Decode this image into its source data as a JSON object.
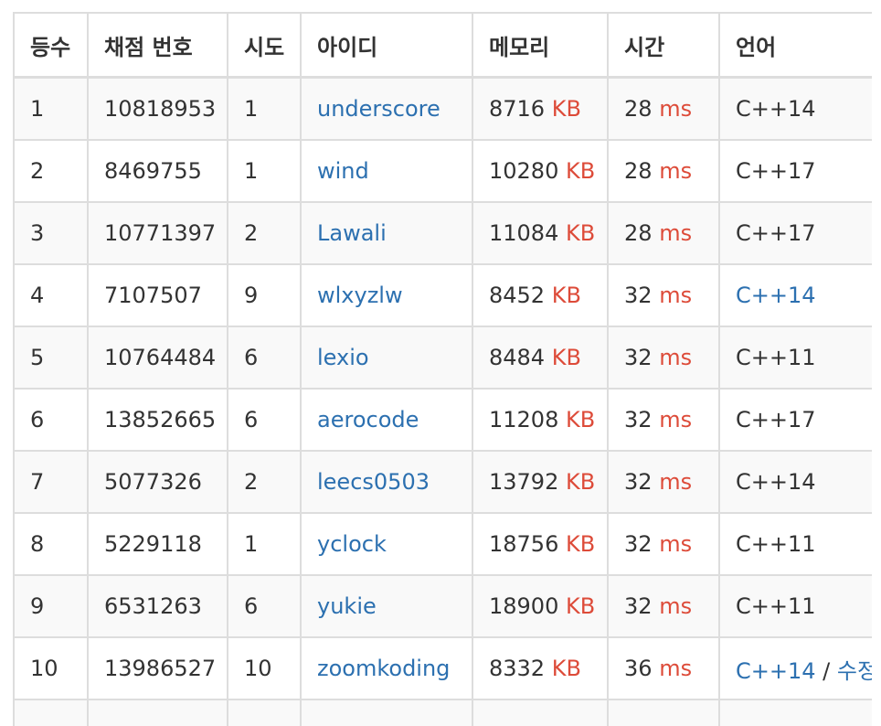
{
  "table": {
    "headers": [
      "등수",
      "채점 번호",
      "시도",
      "아이디",
      "메모리",
      "시간",
      "언어"
    ],
    "mem_unit": "KB",
    "time_unit": "ms",
    "rows": [
      {
        "rank": "1",
        "submission": "10818953",
        "tries": "1",
        "user": "underscore",
        "memory": "8716",
        "time": "28",
        "lang": "C++14",
        "lang_link": false
      },
      {
        "rank": "2",
        "submission": "8469755",
        "tries": "1",
        "user": "wind",
        "memory": "10280",
        "time": "28",
        "lang": "C++17",
        "lang_link": false
      },
      {
        "rank": "3",
        "submission": "10771397",
        "tries": "2",
        "user": "Lawali",
        "memory": "11084",
        "time": "28",
        "lang": "C++17",
        "lang_link": false
      },
      {
        "rank": "4",
        "submission": "7107507",
        "tries": "9",
        "user": "wlxyzlw",
        "memory": "8452",
        "time": "32",
        "lang": "C++14",
        "lang_link": true
      },
      {
        "rank": "5",
        "submission": "10764484",
        "tries": "6",
        "user": "lexio",
        "memory": "8484",
        "time": "32",
        "lang": "C++11",
        "lang_link": false
      },
      {
        "rank": "6",
        "submission": "13852665",
        "tries": "6",
        "user": "aerocode",
        "memory": "11208",
        "time": "32",
        "lang": "C++17",
        "lang_link": false
      },
      {
        "rank": "7",
        "submission": "5077326",
        "tries": "2",
        "user": "leecs0503",
        "memory": "13792",
        "time": "32",
        "lang": "C++14",
        "lang_link": false
      },
      {
        "rank": "8",
        "submission": "5229118",
        "tries": "1",
        "user": "yclock",
        "memory": "18756",
        "time": "32",
        "lang": "C++11",
        "lang_link": false
      },
      {
        "rank": "9",
        "submission": "6531263",
        "tries": "6",
        "user": "yukie",
        "memory": "18900",
        "time": "32",
        "lang": "C++11",
        "lang_link": false
      },
      {
        "rank": "10",
        "submission": "13986527",
        "tries": "10",
        "user": "zoomkoding",
        "memory": "8332",
        "time": "36",
        "lang": "C++14",
        "lang_link": true,
        "edit_sep": "/",
        "edit_label": "수정"
      }
    ]
  },
  "colors": {
    "link": "#2c70b0",
    "unit": "#dd4b39",
    "text": "#333333",
    "stripe": "#f9f9f9",
    "border": "#dddddd"
  }
}
